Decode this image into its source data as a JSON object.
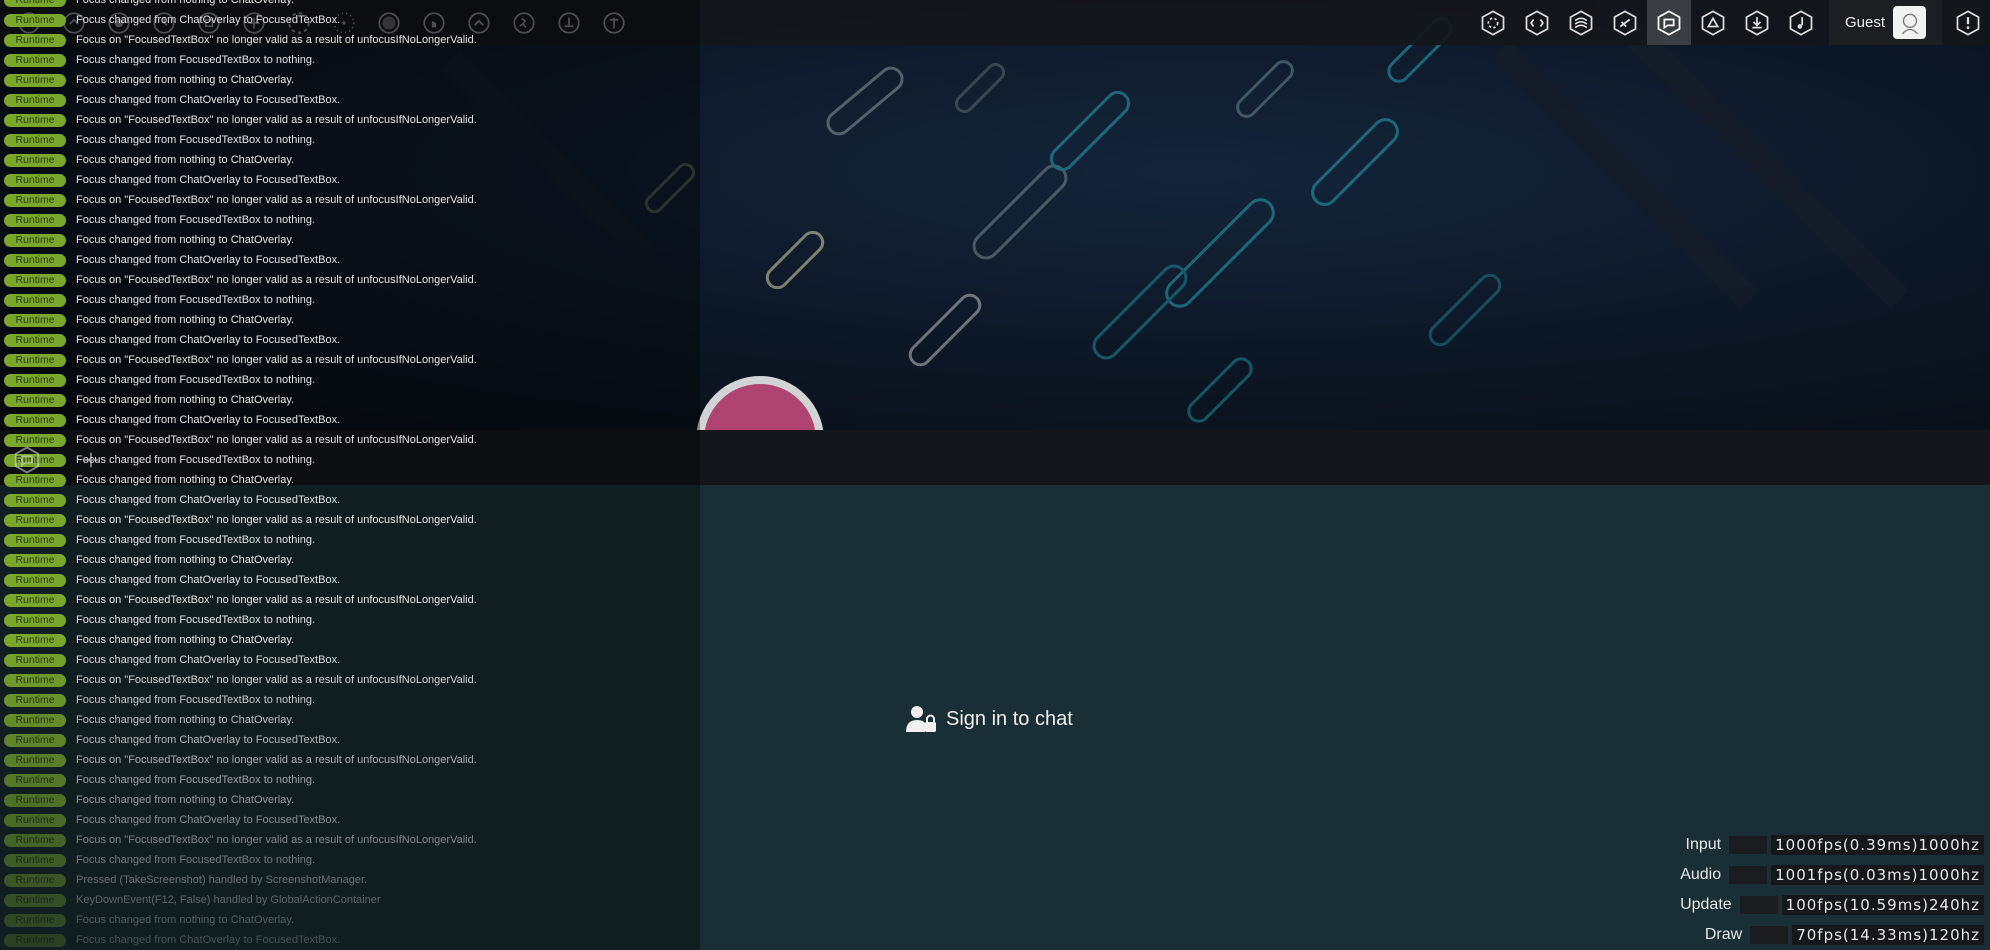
{
  "toolbar": {
    "left_icons": [
      "settings-icon",
      "home-icon",
      "music-icon",
      "clock-icon",
      "mods-icon",
      "cog-icon",
      "dashed-circle-icon",
      "dot-circle-icon",
      "target-icon",
      "hand-icon",
      "chevron-up-icon",
      "runner-icon",
      "joystick-icon",
      "arrow-up-icon"
    ],
    "right_icons": [
      "osu-mode-icon",
      "taiko-icon",
      "catch-icon",
      "mania-icon",
      "chat-icon",
      "triangle-icon",
      "download-icon",
      "note-icon"
    ],
    "user_name": "Guest"
  },
  "log": {
    "badge": "Runtime",
    "rows": [
      "Focus changed from nothing to ChatOverlay.",
      "Focus changed from ChatOverlay to FocusedTextBox.",
      "Focus on \"FocusedTextBox\" no longer valid as a result of unfocusIfNoLongerValid.",
      "Focus changed from FocusedTextBox to nothing.",
      "Focus changed from nothing to ChatOverlay.",
      "Focus changed from ChatOverlay to FocusedTextBox.",
      "Focus on \"FocusedTextBox\" no longer valid as a result of unfocusIfNoLongerValid.",
      "Focus changed from FocusedTextBox to nothing.",
      "Focus changed from nothing to ChatOverlay.",
      "Focus changed from ChatOverlay to FocusedTextBox.",
      "Focus on \"FocusedTextBox\" no longer valid as a result of unfocusIfNoLongerValid.",
      "Focus changed from FocusedTextBox to nothing.",
      "Focus changed from nothing to ChatOverlay.",
      "Focus changed from ChatOverlay to FocusedTextBox.",
      "Focus on \"FocusedTextBox\" no longer valid as a result of unfocusIfNoLongerValid.",
      "Focus changed from FocusedTextBox to nothing.",
      "Focus changed from nothing to ChatOverlay.",
      "Focus changed from ChatOverlay to FocusedTextBox.",
      "Focus on \"FocusedTextBox\" no longer valid as a result of unfocusIfNoLongerValid.",
      "Focus changed from FocusedTextBox to nothing.",
      "Focus changed from nothing to ChatOverlay.",
      "Focus changed from ChatOverlay to FocusedTextBox.",
      "Focus on \"FocusedTextBox\" no longer valid as a result of unfocusIfNoLongerValid.",
      "Focus changed from FocusedTextBox to nothing.",
      "Focus changed from nothing to ChatOverlay.",
      "Focus changed from ChatOverlay to FocusedTextBox.",
      "Focus on \"FocusedTextBox\" no longer valid as a result of unfocusIfNoLongerValid.",
      "Focus changed from FocusedTextBox to nothing.",
      "Focus changed from nothing to ChatOverlay.",
      "Focus changed from ChatOverlay to FocusedTextBox.",
      "Focus on \"FocusedTextBox\" no longer valid as a result of unfocusIfNoLongerValid.",
      "Focus changed from FocusedTextBox to nothing.",
      "Focus changed from nothing to ChatOverlay.",
      "Focus changed from ChatOverlay to FocusedTextBox.",
      "Focus on \"FocusedTextBox\" no longer valid as a result of unfocusIfNoLongerValid.",
      "Focus changed from FocusedTextBox to nothing.",
      "Focus changed from nothing to ChatOverlay.",
      "Focus changed from ChatOverlay to FocusedTextBox.",
      "Focus on \"FocusedTextBox\" no longer valid as a result of unfocusIfNoLongerValid.",
      "Focus changed from FocusedTextBox to nothing.",
      "Focus changed from nothing to ChatOverlay.",
      "Focus changed from ChatOverlay to FocusedTextBox.",
      "Focus on \"FocusedTextBox\" no longer valid as a result of unfocusIfNoLongerValid.",
      "Focus changed from FocusedTextBox to nothing.",
      "Pressed (TakeScreenshot) handled by ScreenshotManager.",
      "KeyDownEvent(F12, False) handled by GlobalActionContainer",
      "Focus changed from nothing to ChatOverlay.",
      "Focus changed from ChatOverlay to FocusedTextBox."
    ]
  },
  "chat": {
    "signin_label": "Sign in to chat"
  },
  "fps": [
    {
      "label": "Input",
      "value": "1000fps(0.39ms)1000hz"
    },
    {
      "label": "Audio",
      "value": "1001fps(0.03ms)1000hz"
    },
    {
      "label": "Update",
      "value": "100fps(10.59ms)240hz"
    },
    {
      "label": "Draw",
      "value": "70fps(14.33ms)120hz"
    }
  ],
  "colors": {
    "badge_bg": "#7ba82b",
    "chat_bg": "#1a2e35",
    "active_button": "#3a3d44"
  }
}
